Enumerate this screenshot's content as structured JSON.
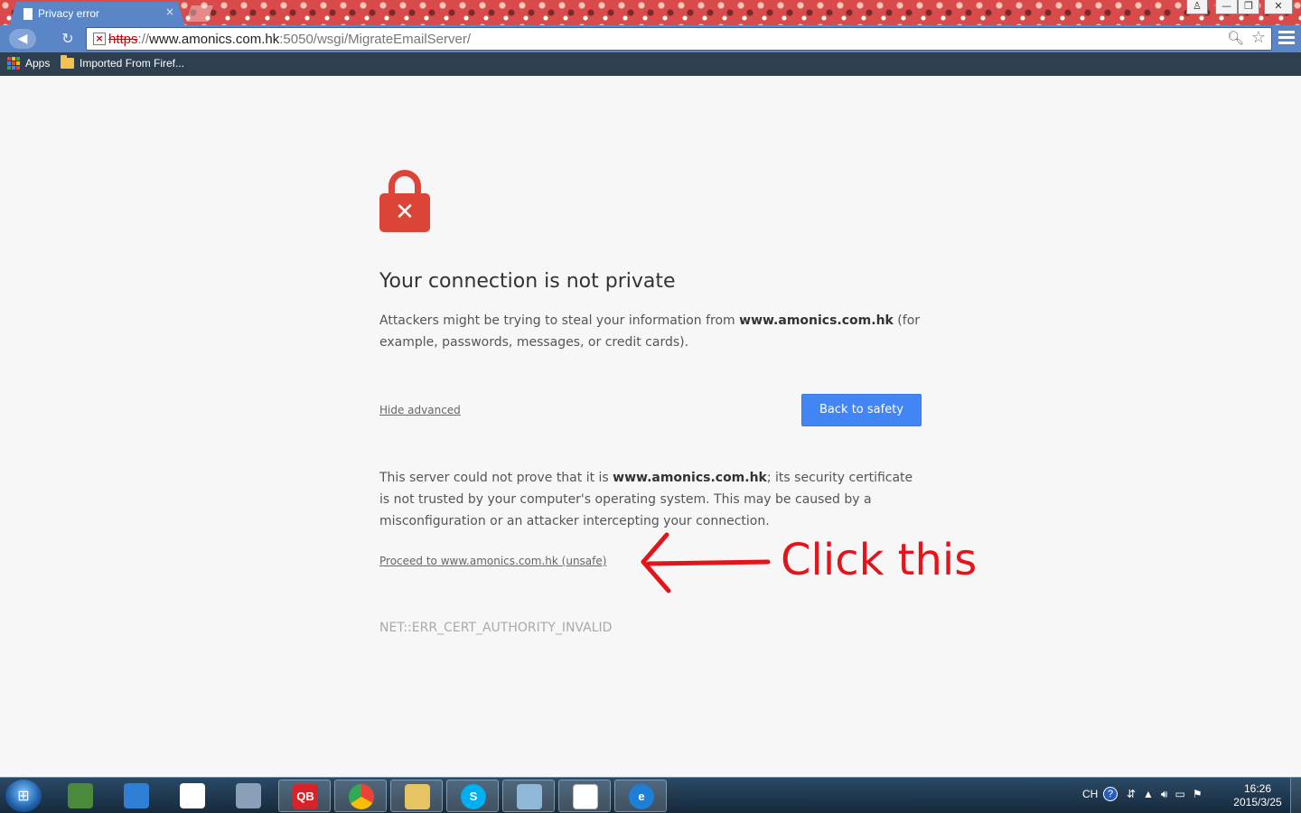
{
  "browser": {
    "tab_title": "Privacy error",
    "tab_close": "×",
    "url_scheme": "https",
    "url_separator": "://",
    "url_host": "www.amonics.com.hk",
    "url_rest": ":5050/wsgi/MigrateEmailServer/",
    "bookmarks": {
      "apps_label": "Apps",
      "folder_label": "Imported From Firef..."
    }
  },
  "page": {
    "heading": "Your connection is not private",
    "intro_before": "Attackers might be trying to steal your information from ",
    "intro_host": "www.amonics.com.hk",
    "intro_after": " (for example, passwords, messages, or credit cards).",
    "hide_advanced": "Hide advanced",
    "back_button": "Back to safety",
    "detail_before": "This server could not prove that it is ",
    "detail_host": "www.amonics.com.hk",
    "detail_after": "; its security certificate is not trusted by your computer's operating system. This may be caused by a misconfiguration or an attacker intercepting your connection.",
    "proceed_link": "Proceed to www.amonics.com.hk (unsafe)",
    "error_code": "NET::ERR_CERT_AUTHORITY_INVALID",
    "annotation": "Click this"
  },
  "taskbar": {
    "pinned": [
      {
        "name": "finance-app",
        "color": "#4a8a3a",
        "label": ""
      },
      {
        "name": "cloud-app",
        "color": "#2f7fd6",
        "label": ""
      },
      {
        "name": "grid-app",
        "color": "#ffffff",
        "label": ""
      },
      {
        "name": "tools-app",
        "color": "#8aa0b8",
        "label": ""
      },
      {
        "name": "qb-app",
        "color": "#d8232a",
        "label": "QB"
      },
      {
        "name": "chrome-app",
        "color": "#e8e8e8",
        "label": ""
      },
      {
        "name": "explorer-app",
        "color": "#e6c463",
        "label": ""
      },
      {
        "name": "skype-app",
        "color": "#00aff0",
        "label": "S"
      },
      {
        "name": "notes-app",
        "color": "#8fb8d8",
        "label": ""
      },
      {
        "name": "blank-doc-app",
        "color": "#ffffff",
        "label": ""
      },
      {
        "name": "ie-app",
        "color": "#1e7fd6",
        "label": "e"
      }
    ],
    "ime": "CH",
    "help": "?",
    "time": "16:26",
    "date": "2015/3/25"
  },
  "colors": {
    "accent": "#4285f4",
    "danger": "#db4437",
    "annotation": "#e3141a"
  }
}
